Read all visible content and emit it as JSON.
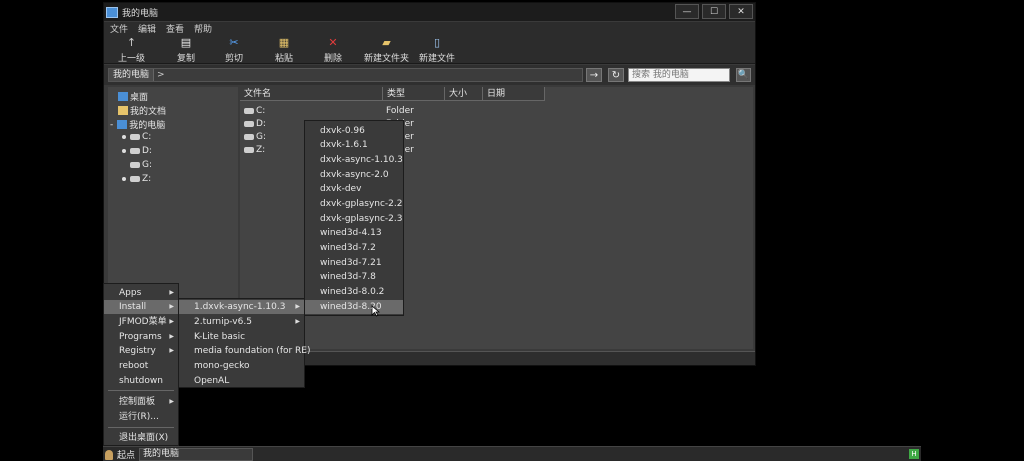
{
  "window": {
    "title": "我的电脑",
    "minimize": "—",
    "maximize": "☐",
    "close": "✕"
  },
  "menubar": [
    "文件",
    "编辑",
    "查看",
    "帮助"
  ],
  "toolbar": [
    {
      "label": "上一级",
      "icon": "↑"
    },
    {
      "label": "复制",
      "icon": "▤"
    },
    {
      "label": "剪切",
      "icon": "✂"
    },
    {
      "label": "粘贴",
      "icon": "▦"
    },
    {
      "label": "删除",
      "icon": "✕"
    },
    {
      "label": "新建文件夹",
      "icon": "▰"
    },
    {
      "label": "新建文件",
      "icon": "▯"
    }
  ],
  "address": {
    "crumb": "我的电脑",
    "separator": ">",
    "go": "→",
    "refresh": "↻",
    "search_placeholder": "搜索 我的电脑",
    "search_icon": "🔍"
  },
  "tree": {
    "desktop": "桌面",
    "documents": "我的文档",
    "computer": "我的电脑",
    "drives": [
      "C:",
      "D:",
      "G:",
      "Z:"
    ],
    "expand_marker": "-"
  },
  "columns": [
    "文件名",
    "类型",
    "大小",
    "日期"
  ],
  "files": [
    {
      "name": "C:",
      "type": "Folder"
    },
    {
      "name": "D:",
      "type": "Folder"
    },
    {
      "name": "G:",
      "type": "Folder"
    },
    {
      "name": "Z:",
      "type": "Folder"
    }
  ],
  "start_menu": {
    "items": [
      "Apps",
      "Install",
      "JFMOD菜单",
      "Programs",
      "Registry",
      "reboot",
      "shutdown"
    ],
    "control_panel": "控制面板",
    "run": "运行(R)...",
    "exit": "退出桌面(X)"
  },
  "install_menu": [
    "1.dxvk-async-1.10.3",
    "2.turnip-v6.5",
    "K-Lite basic",
    "media foundation (for RE)",
    "mono-gecko",
    "OpenAL"
  ],
  "dxvk_menu": [
    "dxvk-0.96",
    "dxvk-1.6.1",
    "dxvk-async-1.10.3",
    "dxvk-async-2.0",
    "dxvk-dev",
    "dxvk-gplasync-2.2",
    "dxvk-gplasync-2.3",
    "wined3d-4.13",
    "wined3d-7.2",
    "wined3d-7.21",
    "wined3d-7.8",
    "wined3d-8.0.2",
    "wined3d-8.20"
  ],
  "taskbar": {
    "start": "起点",
    "task": "我的电脑",
    "tray": "H"
  },
  "arrow_glyph": "▶",
  "colors": {
    "highlight": "#6a6a6a",
    "delete": "#e23c3c",
    "cut": "#5aa8ff"
  }
}
